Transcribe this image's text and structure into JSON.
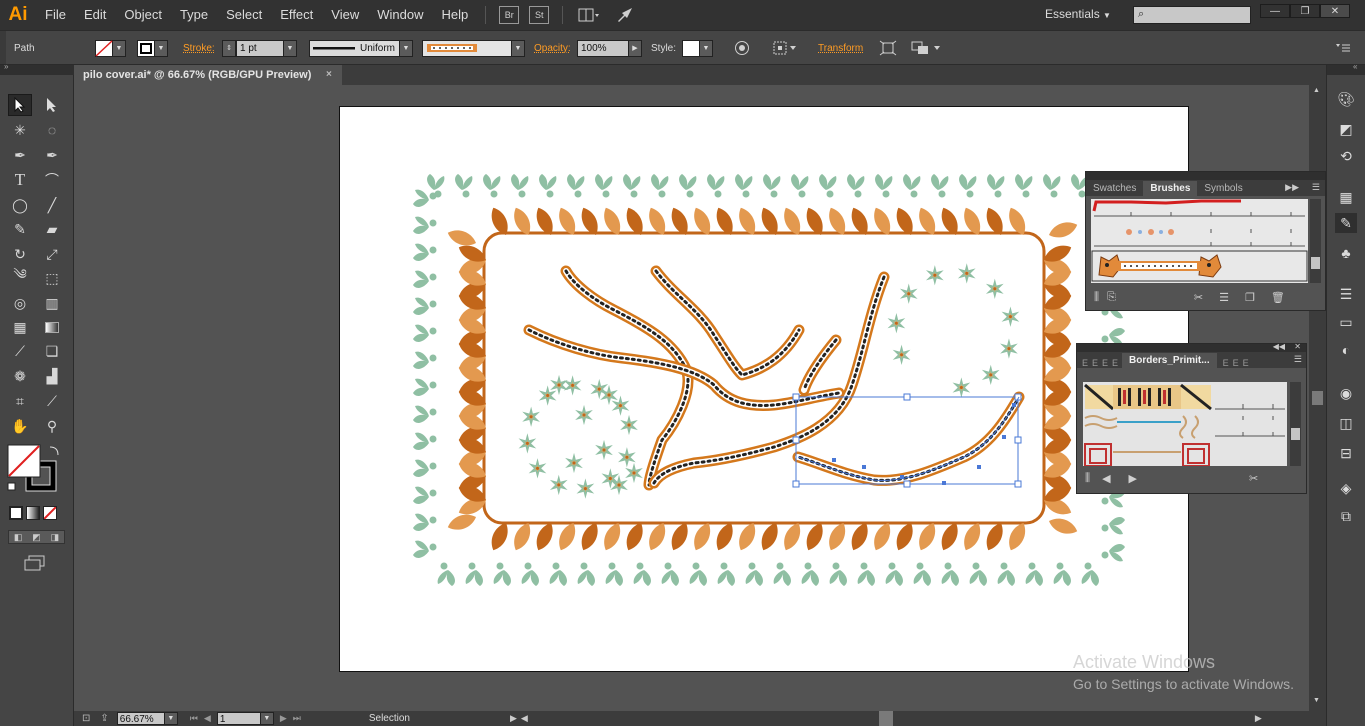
{
  "app": {
    "logo": "Ai",
    "workspace": "Essentials"
  },
  "menu": [
    "File",
    "Edit",
    "Object",
    "Type",
    "Select",
    "Effect",
    "View",
    "Window",
    "Help"
  ],
  "menubar_buttons": {
    "bridge": "Br",
    "stock": "St"
  },
  "window_controls": {
    "minimize": "—",
    "restore": "❐",
    "close": "✕"
  },
  "control": {
    "selection_type": "Path",
    "stroke_label": "Stroke:",
    "stroke_weight": "1 pt",
    "profile": "Uniform",
    "opacity_label": "Opacity:",
    "opacity_value": "100%",
    "style_label": "Style:",
    "transform_label": "Transform"
  },
  "document": {
    "tab_title": "pilo cover.ai* @ 66.67% (RGB/GPU Preview)",
    "close": "×"
  },
  "status": {
    "zoom": "66.67%",
    "artboard_number": "1",
    "tool_status": "Selection"
  },
  "brushes_panel": {
    "tabs": [
      "Swatches",
      "Brushes",
      "Symbols"
    ],
    "active_tab": "Brushes"
  },
  "borders_panel": {
    "tab_label": "Borders_Primit..."
  },
  "watermark": {
    "line1": "Activate Windows",
    "line2": "Go to Settings to activate Windows."
  },
  "colors": {
    "leaf_dark": "#c2661a",
    "leaf_light": "#e3994f",
    "green_leaf": "#8fbfa3",
    "selection_blue": "#4a78d6",
    "accent_orange": "#ff9c24"
  },
  "tools": [
    "selection-tool",
    "direct-selection-tool",
    "magic-wand-tool",
    "lasso-tool",
    "pen-tool",
    "curvature-tool",
    "type-tool",
    "arc-tool",
    "ellipse-tool",
    "paintbrush-tool",
    "pencil-tool",
    "eraser-tool",
    "rotate-tool",
    "scale-tool",
    "warp-tool",
    "free-transform-tool",
    "shape-builder-tool",
    "graph-tool",
    "mesh-tool",
    "gradient-tool",
    "eyedropper-tool",
    "blend-tool",
    "symbol-sprayer-tool",
    "column-graph-tool",
    "artboard-tool",
    "slice-tool",
    "hand-tool",
    "zoom-tool"
  ],
  "dock_icons": [
    "color-icon",
    "color-guide-icon",
    "creative-cloud-icon",
    "swatches-icon",
    "brushes-icon",
    "symbols-icon",
    "stroke-icon",
    "gradient-icon",
    "transparency-icon",
    "appearance-icon",
    "graphic-styles-icon",
    "layers-icon",
    "artboards-icon"
  ]
}
